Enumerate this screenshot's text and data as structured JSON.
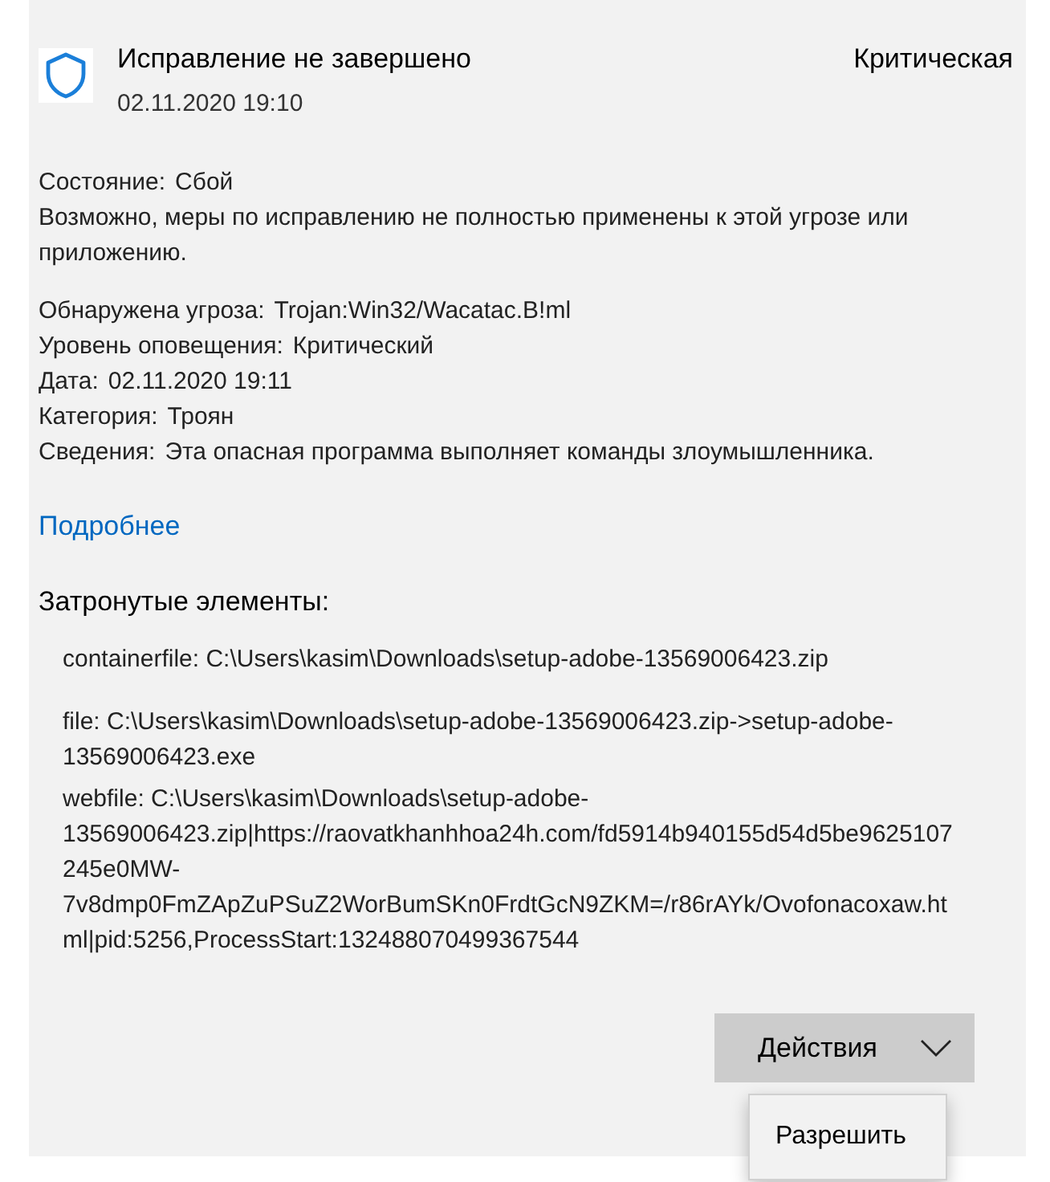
{
  "header": {
    "title": "Исправление не завершено",
    "date": "02.11.2020 19:10",
    "severity": "Критическая"
  },
  "status": {
    "label": "Состояние:",
    "value": "Сбой"
  },
  "status_note": "Возможно, меры по исправлению не полностью применены к этой угрозе или приложению.",
  "details": [
    {
      "label": "Обнаружена угроза:",
      "value": "Trojan:Win32/Wacatac.B!ml"
    },
    {
      "label": "Уровень оповещения:",
      "value": "Критический"
    },
    {
      "label": "Дата:",
      "value": "02.11.2020 19:11"
    },
    {
      "label": "Категория:",
      "value": "Троян"
    },
    {
      "label": "Сведения:",
      "value": "Эта опасная программа выполняет команды злоумышленника."
    }
  ],
  "more_link": "Подробнее",
  "affected_heading": "Затронутые элементы:",
  "affected_items": [
    "containerfile: C:\\Users\\kasim\\Downloads\\setup-adobe-13569006423.zip",
    "file: C:\\Users\\kasim\\Downloads\\setup-adobe-13569006423.zip->setup-adobe-13569006423.exe",
    "webfile: C:\\Users\\kasim\\Downloads\\setup-adobe-13569006423.zip|https://raovatkhanhhoa24h.com/fd5914b940155d54d5be9625107245e0MW-7v8dmp0FmZApZuPSuZ2WorBumSKn0FrdtGcN9ZKM=/r86rAYk/Ovofonacoxaw.html|pid:5256,ProcessStart:132488070499367544"
  ],
  "actions_button": {
    "label": "Действия",
    "expanded": true
  },
  "actions_menu": [
    "Разрешить"
  ]
}
